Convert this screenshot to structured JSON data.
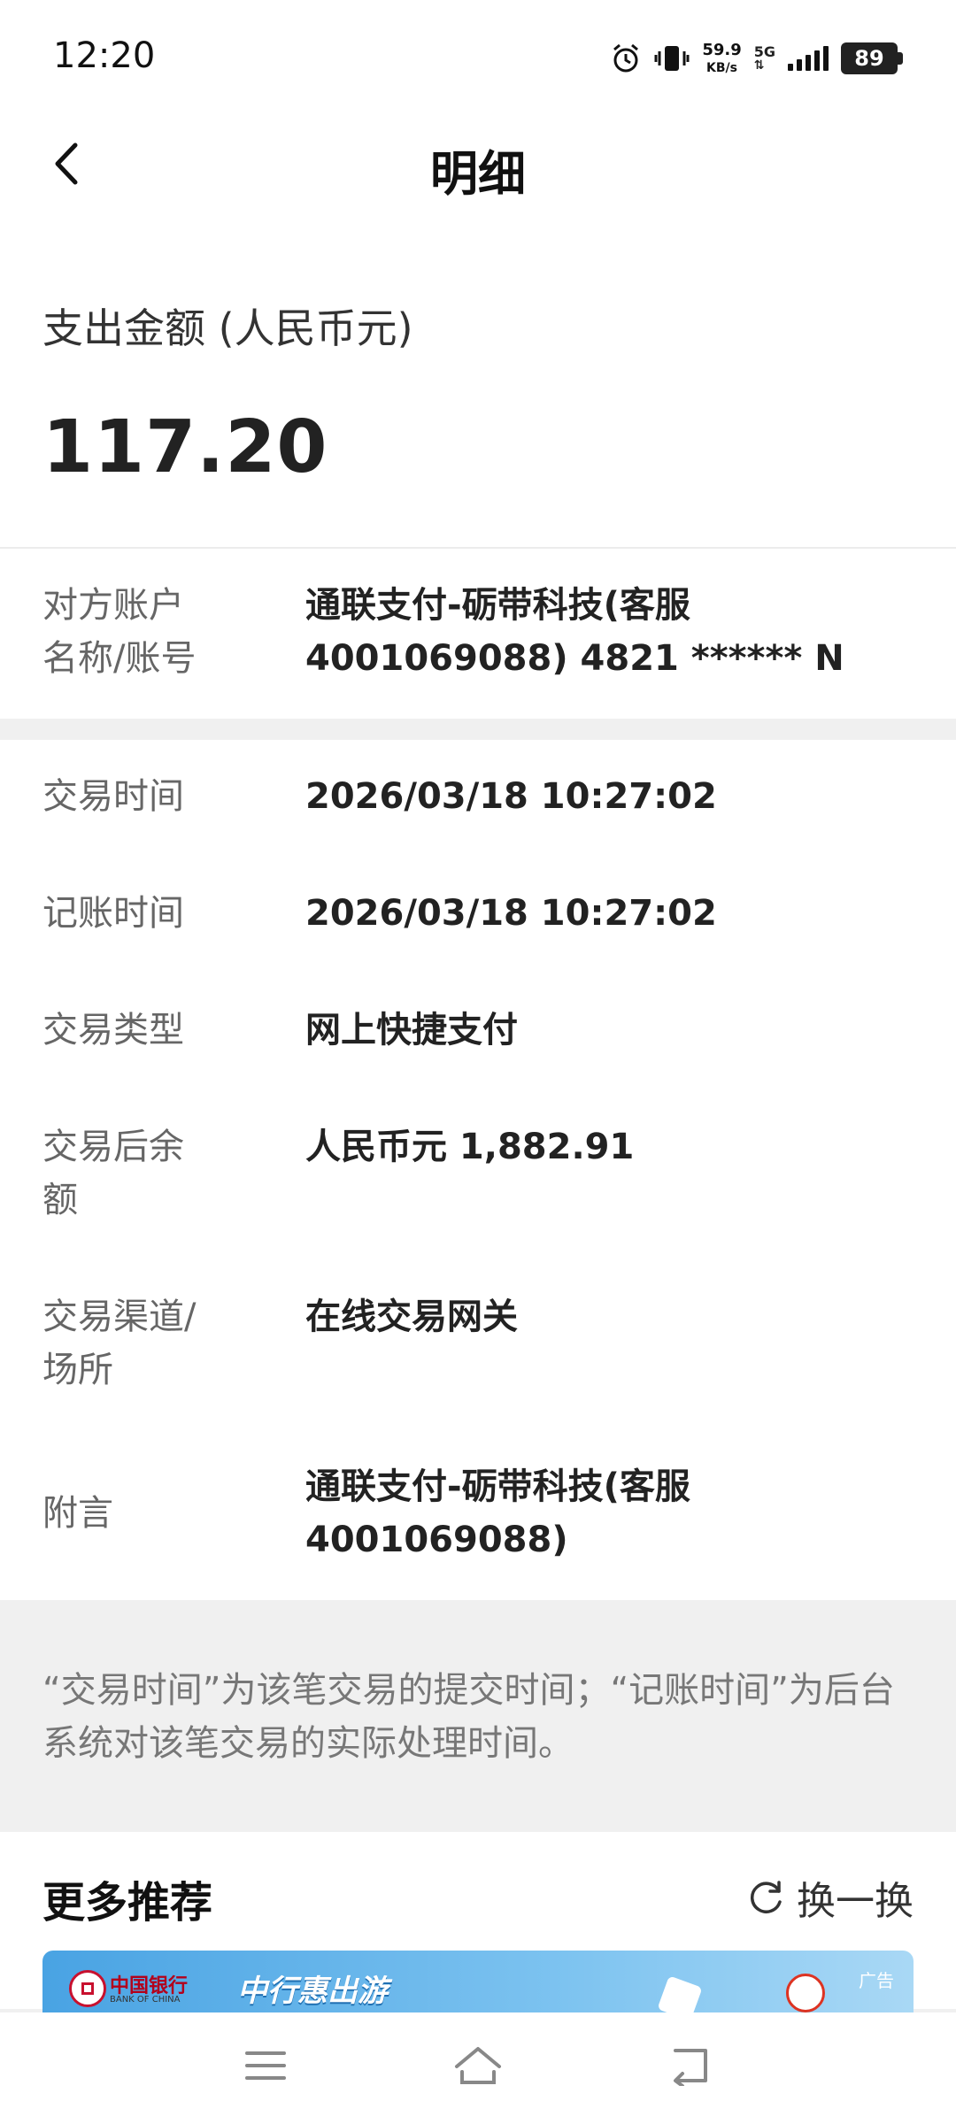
{
  "status_bar": {
    "time": "12:20",
    "net_speed_value": "59.9",
    "net_speed_unit": "KB/s",
    "network": "5G",
    "battery": "89"
  },
  "header": {
    "title": "明细"
  },
  "amount": {
    "label": "支出金额 (人民币元)",
    "value": "117.20"
  },
  "counterparty": {
    "label_line1": "对方账户",
    "label_line2": "名称/账号",
    "value_line1": "通联支付-砺带科技(客服",
    "value_line2": "4001069088) 4821 ****** N"
  },
  "details": [
    {
      "label_line1": "交易时间",
      "label_line2": "",
      "value_line1": "2026/03/18 10:27:02",
      "value_line2": ""
    },
    {
      "label_line1": "记账时间",
      "label_line2": "",
      "value_line1": "2026/03/18 10:27:02",
      "value_line2": ""
    },
    {
      "label_line1": "交易类型",
      "label_line2": "",
      "value_line1": "网上快捷支付",
      "value_line2": ""
    },
    {
      "label_line1": "交易后余",
      "label_line2": "额",
      "value_line1": "人民币元 1,882.91",
      "value_line2": ""
    },
    {
      "label_line1": "交易渠道/",
      "label_line2": "场所",
      "value_line1": "在线交易网关",
      "value_line2": ""
    },
    {
      "label_line1": "附言",
      "label_line2": "",
      "value_line1": "通联支付-砺带科技(客服",
      "value_line2": "4001069088)"
    }
  ],
  "note": {
    "text": "“交易时间”为该笔交易的提交时间；“记账时间”为后台系统对该笔交易的实际处理时间。"
  },
  "recommend": {
    "title": "更多推荐",
    "refresh_label": "换一换"
  },
  "banner": {
    "brand_cn": "中国银行",
    "brand_en": "BANK OF CHINA",
    "slogan": "中行惠出游",
    "ad_tag": "广告"
  },
  "icons": {
    "back": "chevron-left-icon",
    "refresh": "refresh-icon",
    "menu": "menu-icon",
    "home": "home-icon",
    "return": "return-icon",
    "alarm": "alarm-icon",
    "vibrate": "vibrate-icon"
  }
}
